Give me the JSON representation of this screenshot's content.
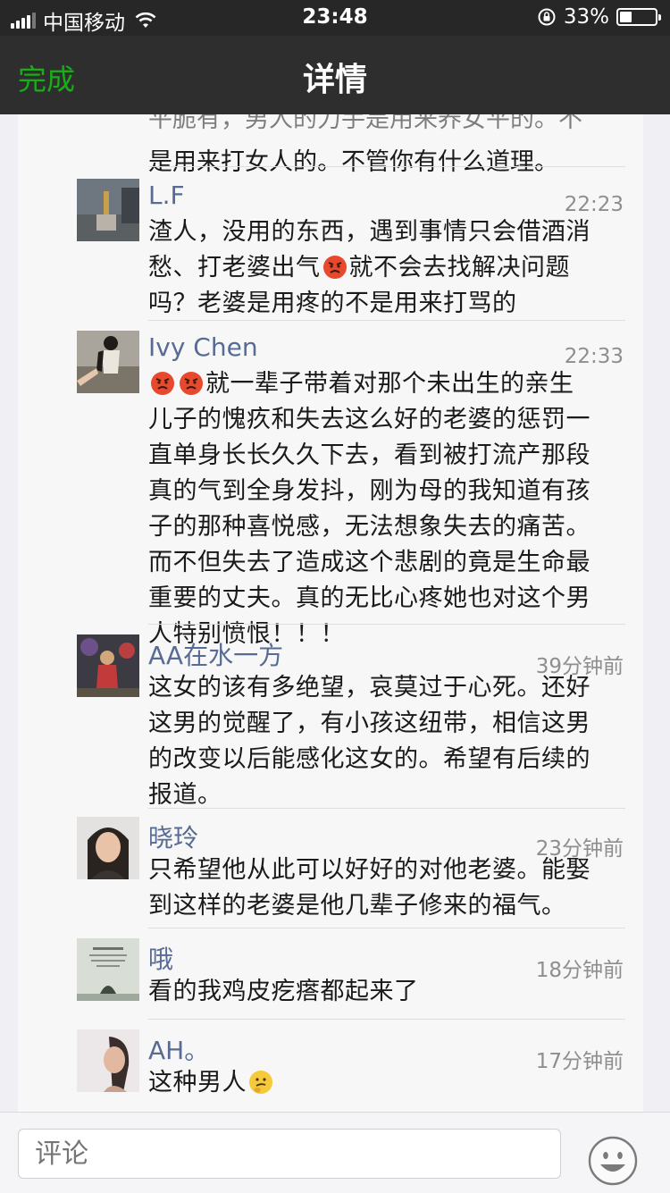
{
  "status_bar": {
    "carrier": "中国移动",
    "time": "23:48",
    "battery": "33%",
    "battery_level": 0.33
  },
  "nav": {
    "done_label": "完成",
    "title": "详情"
  },
  "previous_comment_tail": {
    "line1": "平脆有，男人的力手是用来养女平的。不",
    "line2": "是用来打女人的。不管你有什么道理。"
  },
  "comments": [
    {
      "name": "L.F",
      "time": "22:23",
      "lines": [
        "渣人，没用的东西，遇到事情只会借酒消",
        "愁、打老婆出气",
        "就不会去找解决问题",
        "吗？老婆是用疼的不是用来打骂的"
      ]
    },
    {
      "name": "Ivy Chen",
      "time": "22:33",
      "lines": [
        "就一辈子带着对那个未出生的亲生",
        "儿子的愧疚和失去这么好的老婆的惩罚一",
        "直单身长长久久下去，看到被打流产那段",
        "真的气到全身发抖，刚为母的我知道有孩",
        "子的那种喜悦感，无法想象失去的痛苦。",
        "而不但失去了造成这个悲剧的竟是生命最",
        "重要的丈夫。真的无比心疼她也对这个男",
        "人特别愤恨！！！"
      ]
    },
    {
      "name": "AA在水一方",
      "time": "39分钟前",
      "lines": [
        "这女的该有多绝望，哀莫过于心死。还好",
        "这男的觉醒了，有小孩这纽带，相信这男",
        "的改变以后能感化这女的。希望有后续的",
        "报道。"
      ]
    },
    {
      "name": "晓玲",
      "time": "23分钟前",
      "lines": [
        "只希望他从此可以好好的对他老婆。能娶",
        "到这样的老婆是他几辈子修来的福气。"
      ]
    },
    {
      "name": "哦",
      "time": "18分钟前",
      "lines": [
        "看的我鸡皮疙瘩都起来了"
      ]
    },
    {
      "name": "AH。",
      "time": "17分钟前",
      "lines": [
        "这种男人"
      ]
    }
  ],
  "bottom_bar": {
    "comment_placeholder": "评论"
  }
}
